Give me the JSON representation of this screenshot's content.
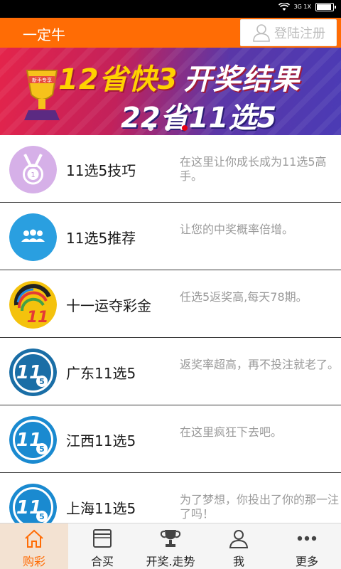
{
  "status": {
    "network": "3G 1X"
  },
  "header": {
    "title": "一定牛",
    "login_label": "登陆注册"
  },
  "banner": {
    "line1_a": "12省快3",
    "line1_b": "开奖结果",
    "line2": "22省11选5",
    "badge": "新手专享"
  },
  "items": [
    {
      "name": "11选5技巧",
      "desc": "在这里让你成长成为11选5高手。",
      "icon": "medal-icon"
    },
    {
      "name": "11选5推荐",
      "desc": "让您的中奖概率倍增。",
      "icon": "users-icon"
    },
    {
      "name": "十一运夺彩金",
      "desc": "任选5返奖高,每天78期。",
      "icon": "lottery-11-logo-icon",
      "icon_text": "11"
    },
    {
      "name": "广东11选5",
      "desc": "返奖率超高，再不投注就老了。",
      "icon": "ball-11-5-icon",
      "icon_text_a": "11",
      "icon_text_b": "5"
    },
    {
      "name": "江西11选5",
      "desc": "在这里疯狂下去吧。",
      "icon": "ball-11-5-icon",
      "icon_text_a": "11",
      "icon_text_b": "5"
    },
    {
      "name": "上海11选5",
      "desc": "为了梦想，你投出了你的那一注了吗！",
      "icon": "ball-11-5-icon",
      "icon_text_a": "11",
      "icon_text_b": "5"
    }
  ],
  "tabs": [
    {
      "label": "购彩",
      "icon": "home-icon",
      "active": true
    },
    {
      "label": "合买",
      "icon": "browser-icon",
      "active": false
    },
    {
      "label": "开奖.走势",
      "icon": "trophy-icon",
      "active": false
    },
    {
      "label": "我",
      "icon": "user-icon",
      "active": false
    },
    {
      "label": "更多",
      "icon": "more-icon",
      "active": false
    }
  ],
  "colors": {
    "brand": "#ff6c05",
    "tab_active_bg": "#f3e2d2"
  }
}
